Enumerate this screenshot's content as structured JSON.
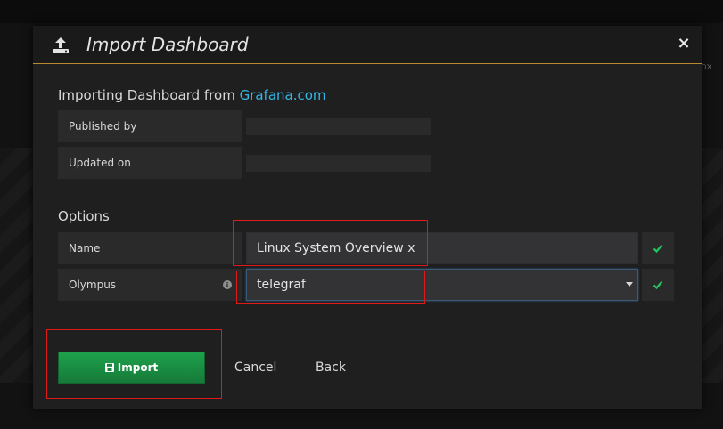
{
  "background": {
    "side_text": "ox"
  },
  "modal": {
    "title": "Import Dashboard",
    "header_icon": "upload-icon",
    "close_label": "×"
  },
  "source": {
    "heading_prefix": "Importing Dashboard from ",
    "heading_link": "Grafana.com",
    "rows": [
      {
        "label": "Published by",
        "value": ""
      },
      {
        "label": "Updated on",
        "value": ""
      }
    ]
  },
  "options": {
    "heading": "Options",
    "name": {
      "label": "Name",
      "value": "Linux System Overview x",
      "valid": true
    },
    "datasource": {
      "label": "Olympus",
      "value": "telegraf",
      "info_icon": "info-circle-icon",
      "valid": true
    }
  },
  "actions": {
    "import_label": "Import",
    "cancel_label": "Cancel",
    "back_label": "Back"
  },
  "colors": {
    "accent": "#b88a2e",
    "link": "#33b5e5",
    "primary_button": "#1fa14c",
    "valid_check": "#23c55e",
    "annotation_highlight": "#e01818"
  }
}
